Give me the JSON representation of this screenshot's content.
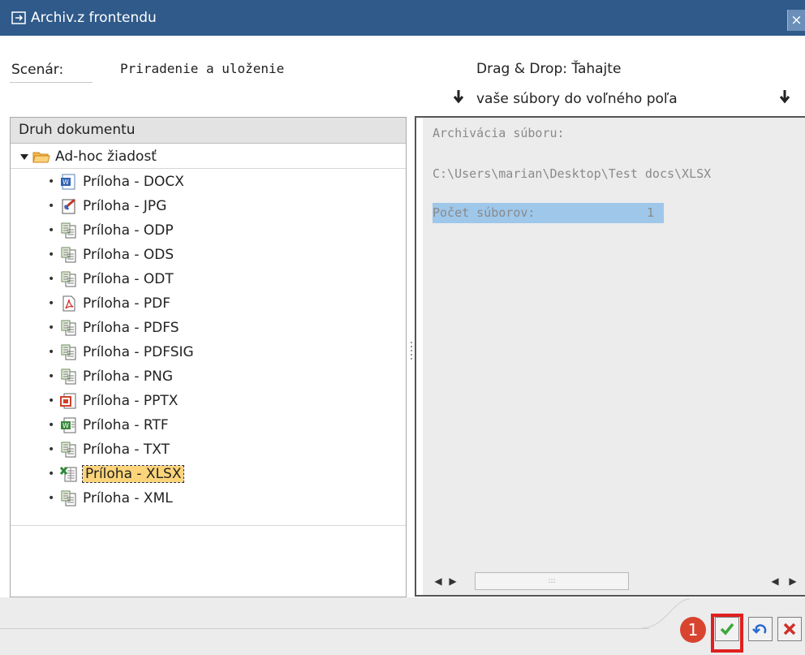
{
  "window": {
    "title": "Archiv.z frontendu",
    "close_glyph": "×"
  },
  "header": {
    "scenario_label": "Scenár:",
    "scenario_value": "Priradenie a uloženie",
    "dragdrop_line1": "Drag & Drop: Ťahajte",
    "dragdrop_line2": "vaše súbory do voľného poľa",
    "arrow_glyph": "🡇"
  },
  "tree": {
    "header": "Druh dokumentu",
    "root": "Ad-hoc žiadosť",
    "items": [
      {
        "label": "Príloha - DOCX",
        "icon": "word-doc-icon"
      },
      {
        "label": "Príloha - JPG",
        "icon": "image-file-icon"
      },
      {
        "label": "Príloha - ODP",
        "icon": "generic-file-icon"
      },
      {
        "label": "Príloha - ODS",
        "icon": "generic-file-icon"
      },
      {
        "label": "Príloha - ODT",
        "icon": "generic-file-icon"
      },
      {
        "label": "Príloha - PDF",
        "icon": "pdf-file-icon"
      },
      {
        "label": "Príloha - PDFS",
        "icon": "generic-file-icon"
      },
      {
        "label": "Príloha - PDFSIG",
        "icon": "generic-file-icon"
      },
      {
        "label": "Príloha - PNG",
        "icon": "generic-file-icon"
      },
      {
        "label": "Príloha - PPTX",
        "icon": "powerpoint-file-icon"
      },
      {
        "label": "Príloha - RTF",
        "icon": "rtf-file-icon"
      },
      {
        "label": "Príloha - TXT",
        "icon": "generic-file-icon"
      },
      {
        "label": "Príloha - XLSX",
        "icon": "excel-file-icon",
        "selected": true
      },
      {
        "label": "Príloha - XML",
        "icon": "generic-file-icon"
      }
    ]
  },
  "archive": {
    "heading": "Archivácia súboru:",
    "path": "C:\\Users\\marian\\Desktop\\Test docs\\XLSX",
    "count_label": "Počet súborov:",
    "count_value": "1"
  },
  "footer": {
    "badge": "1",
    "confirm_icon": "checkmark-icon",
    "undo_icon": "undo-icon",
    "cancel_icon": "cancel-x-icon"
  },
  "colors": {
    "titlebar": "#2f5a8a",
    "selection": "#fcd47a",
    "highlight": "#9ec7ea",
    "badge": "#d94430",
    "confirm_outline": "#e02020"
  }
}
